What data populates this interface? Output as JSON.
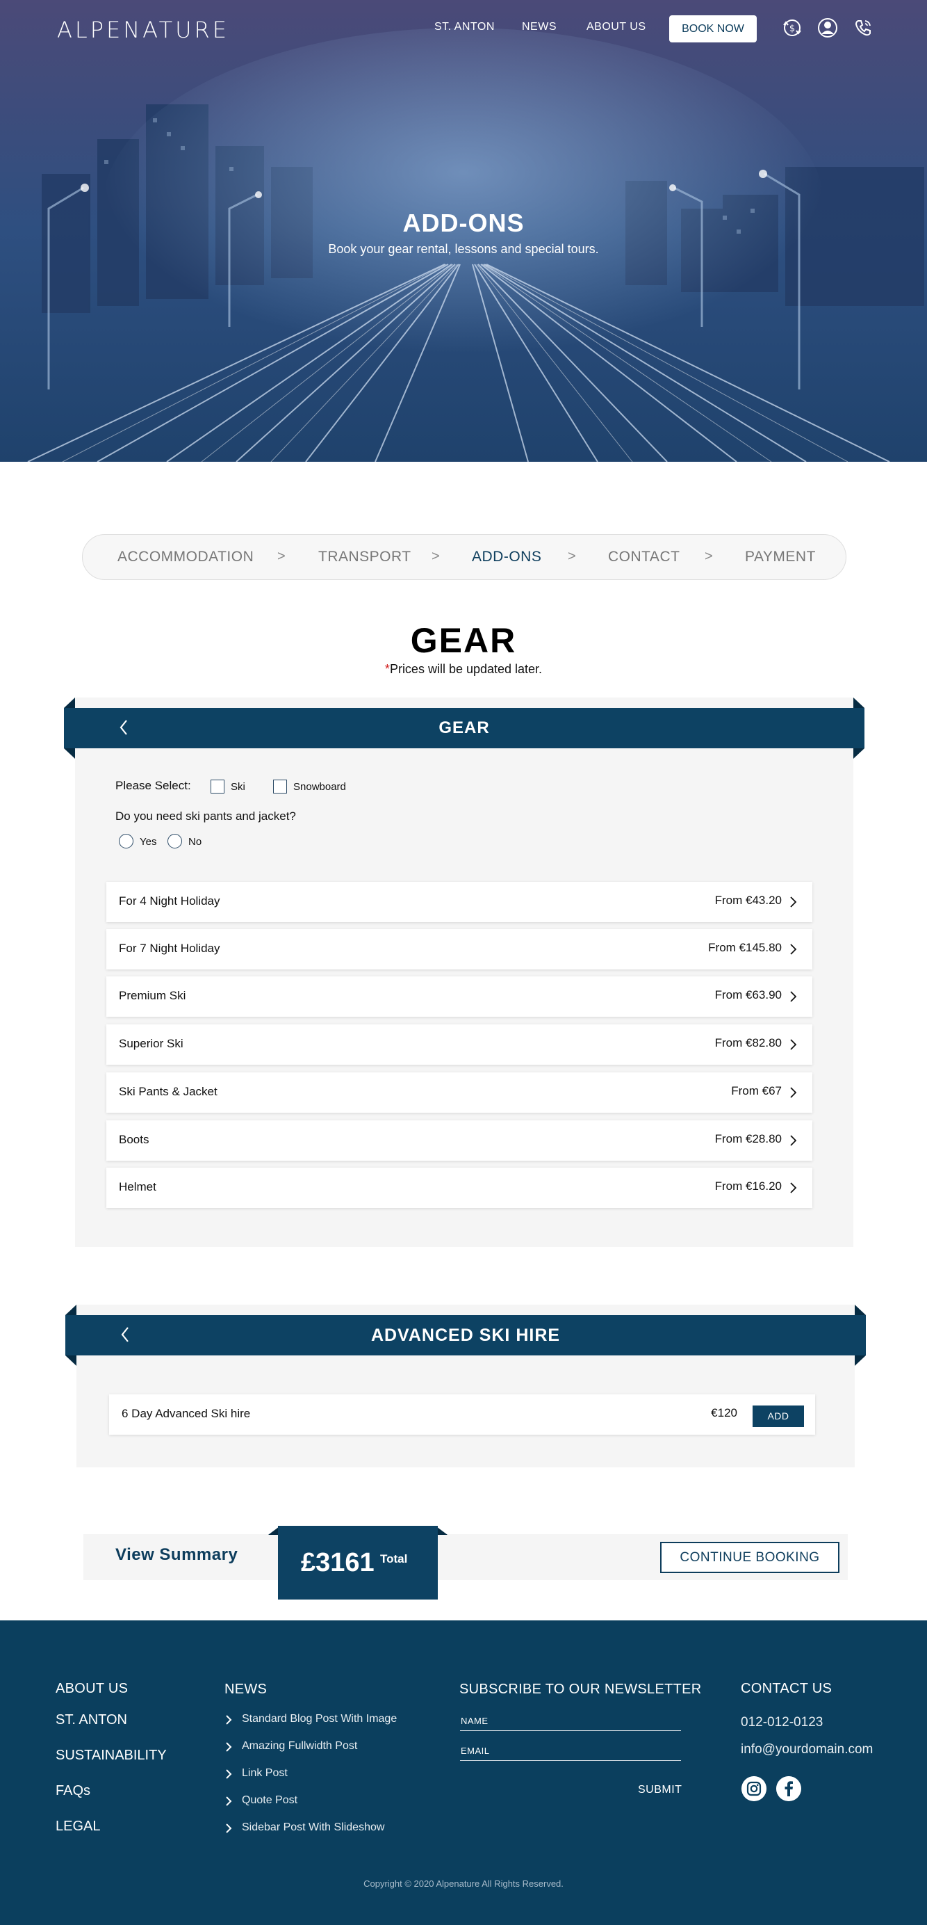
{
  "brand": {
    "logo_text": "ALPENATURE"
  },
  "nav": {
    "items": [
      "ST. ANTON",
      "NEWS",
      "ABOUT US"
    ],
    "book_label": "BOOK NOW",
    "icons": [
      "currency-exchange-icon",
      "user-icon",
      "phone-icon"
    ]
  },
  "hero": {
    "title": "ADD-ONS",
    "subtitle": "Book your gear rental, lessons and special tours."
  },
  "steps": {
    "items": [
      "ACCOMMODATION",
      "TRANSPORT",
      "ADD-ONS",
      "CONTACT",
      "PAYMENT"
    ],
    "separator": ">",
    "active": "ADD-ONS"
  },
  "gear_section": {
    "title": "GEAR",
    "note_star": "*",
    "note": "Prices will be updated later."
  },
  "gear_card": {
    "title": "GEAR",
    "select_label": "Please Select:",
    "options": [
      "Ski",
      "Snowboard"
    ],
    "question": "Do you need ski pants and jacket?",
    "answers": [
      "Yes",
      "No"
    ],
    "items": [
      {
        "name": "For 4 Night Holiday",
        "price": "From €43.20"
      },
      {
        "name": "For 7 Night Holiday",
        "price": "From €145.80"
      },
      {
        "name": "Premium Ski",
        "price": "From €63.90"
      },
      {
        "name": "Superior Ski",
        "price": "From €82.80"
      },
      {
        "name": "Ski Pants & Jacket",
        "price": "From €67"
      },
      {
        "name": "Boots",
        "price": "From €28.80"
      },
      {
        "name": "Helmet",
        "price": "From €16.20"
      }
    ]
  },
  "advanced_card": {
    "title": "ADVANCED SKI HIRE",
    "item": {
      "name": "6 Day Advanced Ski hire",
      "price": "€120",
      "button": "ADD"
    }
  },
  "summary": {
    "view_label": "View Summary",
    "total_amount": "£3161",
    "total_label": "Total",
    "continue_label": "CONTINUE BOOKING"
  },
  "footer": {
    "col1": {
      "head": "ABOUT US",
      "links": [
        "ST. ANTON",
        "SUSTAINABILITY",
        "FAQs",
        "LEGAL"
      ]
    },
    "col2": {
      "head": "NEWS",
      "links": [
        "Standard Blog Post With Image",
        "Amazing Fullwidth Post",
        "Link Post",
        "Quote Post",
        "Sidebar Post With Slideshow"
      ]
    },
    "newsletter": {
      "head": "SUBSCRIBE TO OUR NEWSLETTER",
      "name_placeholder": "NAME",
      "email_placeholder": "EMAIL",
      "submit": "SUBMIT"
    },
    "contact": {
      "head": "CONTACT US",
      "phone": "012-012-0123",
      "email": "info@yourdomain.com",
      "social": [
        "instagram-icon",
        "facebook-icon"
      ]
    },
    "copyright": "Copyright © 2020  Alpenature  All Rights Reserved."
  },
  "colors": {
    "brand_navy": "#0d4263",
    "footer_bg": "#0b3f5e",
    "asterisk": "#d21e1e"
  }
}
